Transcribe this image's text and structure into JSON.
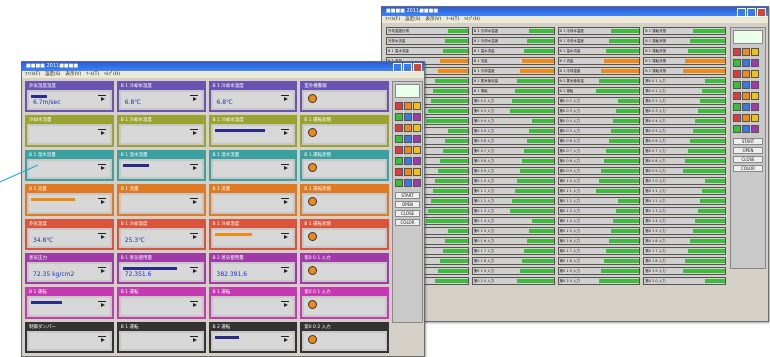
{
  "front_window": {
    "title": "■■■■ 2011■■■■",
    "menu": [
      "ﾌｧｲﾙ(F)",
      "設定(S)",
      "表示(V)",
      "ﾂｰﾙ(T)",
      "ﾍﾙﾌﾟ(H)"
    ],
    "panels": [
      {
        "header": "外気湿度温度",
        "value": "6.7m/sec",
        "color": "#6a54b2"
      },
      {
        "header": "B 1 冷却水温度",
        "value": "6.8℃",
        "color": "#6a54b2"
      },
      {
        "header": "B 1 冷却水温度",
        "value": "6.8℃",
        "color": "#6a54b2"
      },
      {
        "header": "室外機警報",
        "value": "",
        "color": "#6a54b2"
      },
      {
        "header": "冷却水流量",
        "value": "",
        "color": "#9aa331"
      },
      {
        "header": "B 1 冷却水温度",
        "value": "",
        "color": "#9aa331"
      },
      {
        "header": "B 1 冷却水温度",
        "value": "",
        "color": "#9aa331"
      },
      {
        "header": "B 1 運転状態",
        "value": "",
        "color": "#9aa331"
      },
      {
        "header": "B 1 温水流量",
        "value": "",
        "color": "#3aa0a0"
      },
      {
        "header": "B 1 温水流量",
        "value": "",
        "color": "#3aa0a0"
      },
      {
        "header": "B 1 温水流量",
        "value": "",
        "color": "#3aa0a0"
      },
      {
        "header": "B 1 運転状態",
        "value": "",
        "color": "#3aa0a0"
      },
      {
        "header": "B 1 流量",
        "value": "",
        "color": "#e07a22"
      },
      {
        "header": "B 1 流量",
        "value": "",
        "color": "#e07a22"
      },
      {
        "header": "B 1 流量",
        "value": "",
        "color": "#e07a22"
      },
      {
        "header": "B 1 運転状態",
        "value": "",
        "color": "#e07a22"
      },
      {
        "header": "外気温度",
        "value": "34.8℃",
        "color": "#d9543a"
      },
      {
        "header": "B 1 冷却温度",
        "value": "25.3℃",
        "color": "#d9543a"
      },
      {
        "header": "B 1 冷却温度",
        "value": "",
        "color": "#d9543a"
      },
      {
        "header": "B 1 運転状態",
        "value": "",
        "color": "#d9543a"
      },
      {
        "header": "蒸気圧力",
        "value": "72.35 kg/cm2",
        "color": "#a03aa8"
      },
      {
        "header": "B 1 蒸気使用量",
        "value": "72.351.6",
        "color": "#a03aa8"
      },
      {
        "header": "B 2 蒸気使用量",
        "value": "382.391.6",
        "color": "#a03aa8"
      },
      {
        "header": "第0 0 1 入力",
        "value": "",
        "color": "#a03aa8"
      },
      {
        "header": "B 1 運転",
        "value": "",
        "color": "#c43ab0"
      },
      {
        "header": "B 1 運転",
        "value": "",
        "color": "#c43ab0"
      },
      {
        "header": "B 1 運転",
        "value": "",
        "color": "#c43ab0"
      },
      {
        "header": "第0 0 1 入力",
        "value": "",
        "color": "#c43ab0"
      },
      {
        "header": "制御ダンパー",
        "value": "",
        "color": "#333333"
      },
      {
        "header": "B 1 運転",
        "value": "",
        "color": "#333333"
      },
      {
        "header": "B 2 運転",
        "value": "",
        "color": "#333333"
      },
      {
        "header": "第0 0 2 入力",
        "value": "",
        "color": "#333333"
      }
    ],
    "side_buttons": [
      "START",
      "OPEN",
      "CLOSE",
      "COLOR"
    ]
  },
  "back_window": {
    "title": "■■■■ 2011■■■■",
    "menu": [
      "ﾌｧｲﾙ(F)",
      "設定(S)",
      "表示(V)",
      "ﾂｰﾙ(T)",
      "ﾍﾙﾌﾟ(H)"
    ],
    "rows": [
      [
        "外気温度計測",
        "B 1 冷却水温度",
        "B 1 冷却水温度",
        "B 1 運転状態"
      ],
      [
        "冷却水流量",
        "B 1 冷却水温度",
        "B 1 冷却水温度",
        "B 1 運転状態"
      ],
      [
        "B 1 温水流量",
        "B 1 温水流量",
        "B 1 温水流量",
        "B 1 運転状態"
      ],
      [
        "B 1 流量",
        "B 1 流量",
        "B 1 流量",
        "B 1 運転状態"
      ],
      [
        "外気温度",
        "B 1 冷却温度",
        "B 1 冷却温度",
        "B 1 運転状態"
      ],
      [
        "蒸気圧力",
        "B 1 蒸気使用量",
        "B 2 蒸気使用量",
        "第0 0 1 入力"
      ],
      [
        "B 1 運転",
        "B 1 運転",
        "B 1 運転",
        "第0 0 1 入力"
      ],
      [
        "第0 0 2 入力",
        "第0 0 2 入力",
        "第0 0 2 入力",
        "第0 0 2 入力"
      ],
      [
        "第0 0 3 入力",
        "第0 0 3 入力",
        "第0 0 3 入力",
        "第0 0 3 入力"
      ],
      [
        "第0 0 4 入力",
        "第0 0 4 入力",
        "第0 0 4 入力",
        "第0 0 4 入力"
      ],
      [
        "第0 0 5 入力",
        "第0 0 5 入力",
        "第0 0 5 入力",
        "第0 0 5 入力"
      ],
      [
        "第0 0 6 入力",
        "第0 0 6 入力",
        "第0 0 6 入力",
        "第0 0 6 入力"
      ],
      [
        "第0 0 7 入力",
        "第0 0 7 入力",
        "第0 0 7 入力",
        "第0 0 7 入力"
      ],
      [
        "第0 0 8 入力",
        "第0 0 8 入力",
        "第0 0 8 入力",
        "第0 0 8 入力"
      ],
      [
        "第0 0 9 入力",
        "第0 0 9 入力",
        "第0 0 9 入力",
        "第0 0 9 入力"
      ],
      [
        "第0 1 0 入力",
        "第0 1 0 入力",
        "第0 1 0 入力",
        "第0 1 0 入力"
      ],
      [
        "第0 1 1 入力",
        "第0 1 1 入力",
        "第0 1 1 入力",
        "第0 1 1 入力"
      ],
      [
        "第0 1 2 入力",
        "第0 1 2 入力",
        "第0 1 2 入力",
        "第0 1 2 入力"
      ],
      [
        "第0 1 3 入力",
        "第0 1 3 入力",
        "第0 1 3 入力",
        "第0 1 3 入力"
      ],
      [
        "第0 1 4 入力",
        "第0 1 4 入力",
        "第0 1 4 入力",
        "第0 1 4 入力"
      ],
      [
        "第0 1 5 入力",
        "第0 1 5 入力",
        "第0 1 5 入力",
        "第0 1 5 入力"
      ],
      [
        "第0 1 6 入力",
        "第0 1 6 入力",
        "第0 1 6 入力",
        "第0 1 6 入力"
      ],
      [
        "第0 1 7 入力",
        "第0 1 7 入力",
        "第0 1 7 入力",
        "第0 1 7 入力"
      ],
      [
        "第0 1 8 入力",
        "第0 1 8 入力",
        "第0 1 8 入力",
        "第0 1 8 入力"
      ],
      [
        "第0 1 9 入力",
        "第0 1 9 入力",
        "第0 1 9 入力",
        "第0 1 9 入力"
      ],
      [
        "第0 2 0 入力",
        "第0 2 0 入力",
        "第0 2 0 入力",
        "第0 2 0 入力"
      ]
    ],
    "side_buttons": [
      "START",
      "OPEN",
      "CLOSE",
      "COLOR"
    ],
    "accent_green": "#3bbf3b",
    "accent_orange": "#f08a12"
  }
}
